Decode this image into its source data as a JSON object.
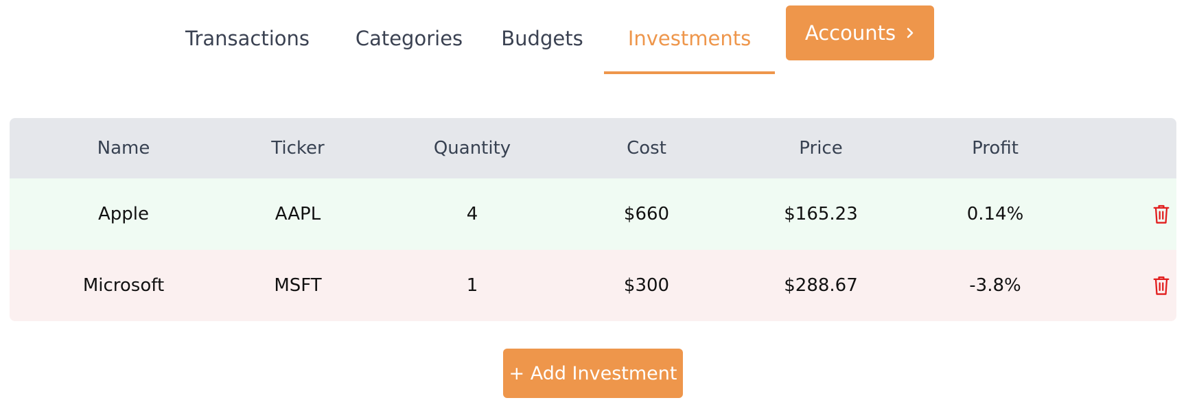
{
  "nav": {
    "tabs": [
      {
        "label": "Transactions",
        "active": false
      },
      {
        "label": "Categories",
        "active": false
      },
      {
        "label": "Budgets",
        "active": false
      },
      {
        "label": "Investments",
        "active": true
      }
    ],
    "accounts_label": "Accounts",
    "accounts_icon": "chevron-right-icon"
  },
  "table": {
    "headers": [
      "Name",
      "Ticker",
      "Quantity",
      "Cost",
      "Price",
      "Profit"
    ],
    "rows": [
      {
        "name": "Apple",
        "ticker": "AAPL",
        "quantity": "4",
        "cost": "$660",
        "price": "$165.23",
        "profit": "0.14%",
        "status": "gain",
        "action_icon": "trash-icon"
      },
      {
        "name": "Microsoft",
        "ticker": "MSFT",
        "quantity": "1",
        "cost": "$300",
        "price": "$288.67",
        "profit": "-3.8%",
        "status": "loss",
        "action_icon": "trash-icon"
      }
    ]
  },
  "add_button_label": "+ Add Investment",
  "colors": {
    "accent": "#ee964b",
    "header_bg": "#e5e7eb",
    "gain_row_bg": "#f0fbf3",
    "loss_row_bg": "#fbf0f0",
    "delete": "#e11d1d"
  }
}
